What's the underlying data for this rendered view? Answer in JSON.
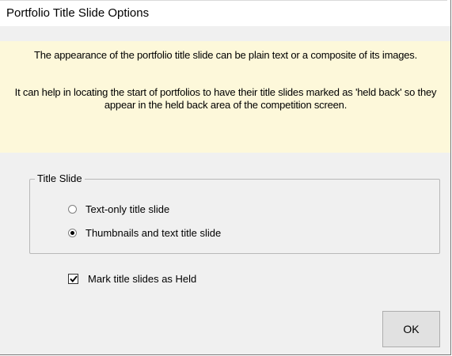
{
  "window": {
    "title": "Portfolio Title Slide Options"
  },
  "info": {
    "paragraph1": "The appearance of the portfolio title slide can be plain text or a composite of its images.",
    "paragraph2": "It can help in locating the start of portfolios to have their title slides marked as 'held back' so they appear in the held back area of the competition screen.",
    "background_color": "#fdf8da"
  },
  "title_slide_group": {
    "legend": "Title Slide",
    "options": [
      {
        "label": "Text-only title slide",
        "selected": false
      },
      {
        "label": "Thumbnails and text title slide",
        "selected": true
      }
    ]
  },
  "mark_held": {
    "label": "Mark title slides as Held",
    "checked": true
  },
  "buttons": {
    "ok_label": "OK"
  }
}
